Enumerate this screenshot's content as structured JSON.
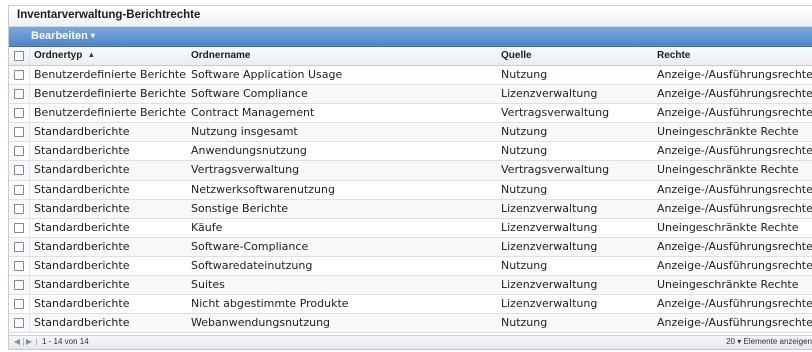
{
  "panel": {
    "title": "Inventarverwaltung-Berichtrechte"
  },
  "toolbar": {
    "edit_label": "Bearbeiten",
    "edit_caret": "▾"
  },
  "table": {
    "headers": {
      "type": "Ordnertyp",
      "name": "Ordnername",
      "source": "Quelle",
      "rights": "Rechte"
    },
    "sort_indicator": "▲",
    "rows": [
      {
        "type": "Benutzerdefinierte Berichte",
        "name": "Software Application Usage",
        "source": "Nutzung",
        "rights": "Anzeige-/Ausführungsrechte"
      },
      {
        "type": "Benutzerdefinierte Berichte",
        "name": "Software Compliance",
        "source": "Lizenzverwaltung",
        "rights": "Anzeige-/Ausführungsrechte"
      },
      {
        "type": "Benutzerdefinierte Berichte",
        "name": "Contract Management",
        "source": "Vertragsverwaltung",
        "rights": "Anzeige-/Ausführungsrechte"
      },
      {
        "type": "Standardberichte",
        "name": "Nutzung insgesamt",
        "source": "Nutzung",
        "rights": "Uneingeschränkte Rechte"
      },
      {
        "type": "Standardberichte",
        "name": "Anwendungsnutzung",
        "source": "Nutzung",
        "rights": "Anzeige-/Ausführungsrechte"
      },
      {
        "type": "Standardberichte",
        "name": "Vertragsverwaltung",
        "source": "Vertragsverwaltung",
        "rights": "Uneingeschränkte Rechte"
      },
      {
        "type": "Standardberichte",
        "name": "Netzwerksoftwarenutzung",
        "source": "Nutzung",
        "rights": "Anzeige-/Ausführungsrechte"
      },
      {
        "type": "Standardberichte",
        "name": "Sonstige Berichte",
        "source": "Lizenzverwaltung",
        "rights": "Anzeige-/Ausführungsrechte"
      },
      {
        "type": "Standardberichte",
        "name": "Käufe",
        "source": "Lizenzverwaltung",
        "rights": "Uneingeschränkte Rechte"
      },
      {
        "type": "Standardberichte",
        "name": "Software-Compliance",
        "source": "Lizenzverwaltung",
        "rights": "Anzeige-/Ausführungsrechte"
      },
      {
        "type": "Standardberichte",
        "name": "Softwaredateinutzung",
        "source": "Nutzung",
        "rights": "Anzeige-/Ausführungsrechte"
      },
      {
        "type": "Standardberichte",
        "name": "Suites",
        "source": "Lizenzverwaltung",
        "rights": "Uneingeschränkte Rechte"
      },
      {
        "type": "Standardberichte",
        "name": "Nicht abgestimmte Produkte",
        "source": "Lizenzverwaltung",
        "rights": "Anzeige-/Ausführungsrechte"
      },
      {
        "type": "Standardberichte",
        "name": "Webanwendungsnutzung",
        "source": "Nutzung",
        "rights": "Anzeige-/Ausführungsrechte"
      }
    ]
  },
  "footer": {
    "prev_symbol": "◀",
    "next_symbol": "▶",
    "range": "1 - 14 von 14",
    "page_size_value": "20",
    "page_size_caret": "▾",
    "page_size_label": "Elemente anzeigen"
  },
  "colors": {
    "toolbar_blue": "#5b8fd1",
    "header_gray": "#eceff2",
    "border": "#c7ccd2"
  },
  "icons": {
    "checkbox": "checkbox-icon",
    "sort": "sort-ascending-icon",
    "dropdown": "chevron-down-icon",
    "prev": "previous-page-icon",
    "next": "next-page-icon"
  }
}
